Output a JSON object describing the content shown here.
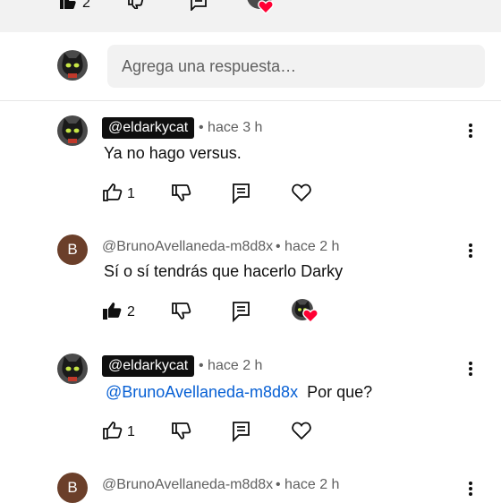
{
  "top_bar": {
    "like_count": "2"
  },
  "reply_box": {
    "placeholder": "Agrega una respuesta…"
  },
  "comments": [
    {
      "author": "@eldarkycat",
      "author_is_creator": true,
      "time": "• hace 3 h",
      "text": "Ya no hago versus.",
      "likes": "1",
      "creator_heart": false
    },
    {
      "author": "@BrunoAvellaneda-m8d8x",
      "author_is_creator": false,
      "avatar_letter": "B",
      "time": "• hace 2 h",
      "text": "Sí o sí tendrás que hacerlo Darky",
      "likes": "2",
      "creator_heart": true,
      "liked": true
    },
    {
      "author": "@eldarkycat",
      "author_is_creator": true,
      "time": "• hace 2 h",
      "mention": "@BrunoAvellaneda-m8d8x",
      "text": "Por que?",
      "likes": "1",
      "creator_heart": false
    },
    {
      "author": "@BrunoAvellaneda-m8d8x",
      "author_is_creator": false,
      "avatar_letter": "B",
      "time": "• hace 2 h"
    }
  ],
  "colors": {
    "mention": "#065fd4",
    "heart": "#ff0033",
    "avatar_b": "#6b3f2a"
  }
}
